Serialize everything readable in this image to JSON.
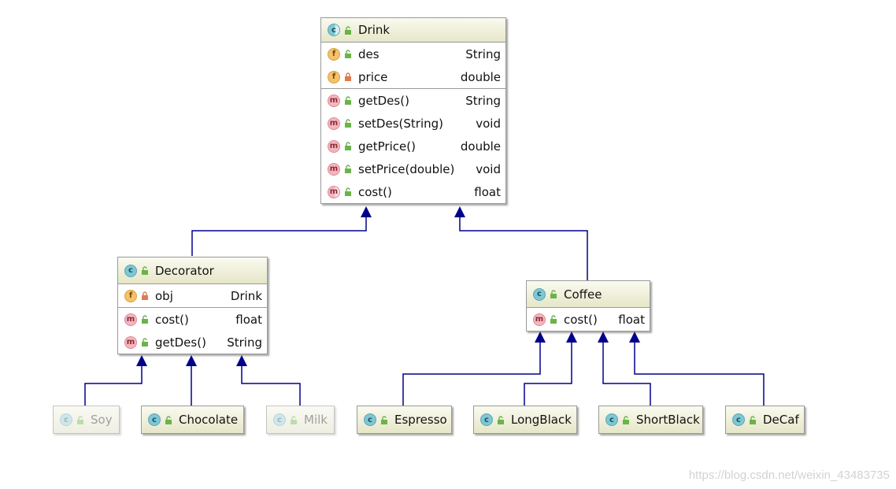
{
  "drink": {
    "name": "Drink",
    "fields": [
      {
        "name": "des",
        "type": "String",
        "visibility": "public"
      },
      {
        "name": "price",
        "type": "double",
        "visibility": "private"
      }
    ],
    "methods": [
      {
        "name": "getDes()",
        "type": "String"
      },
      {
        "name": "setDes(String)",
        "type": "void"
      },
      {
        "name": "getPrice()",
        "type": "double"
      },
      {
        "name": "setPrice(double)",
        "type": "void"
      },
      {
        "name": "cost()",
        "type": "float"
      }
    ]
  },
  "decorator": {
    "name": "Decorator",
    "fields": [
      {
        "name": "obj",
        "type": "Drink",
        "visibility": "private"
      }
    ],
    "methods": [
      {
        "name": "cost()",
        "type": "float"
      },
      {
        "name": "getDes()",
        "type": "String"
      }
    ]
  },
  "coffee": {
    "name": "Coffee",
    "methods": [
      {
        "name": "cost()",
        "type": "float"
      }
    ]
  },
  "leaves": {
    "soy": "Soy",
    "chocolate": "Chocolate",
    "milk": "Milk",
    "espresso": "Espresso",
    "longblack": "LongBlack",
    "shortblack": "ShortBlack",
    "decaf": "DeCaf"
  },
  "badges": {
    "class": "c",
    "field": "f",
    "method": "m"
  },
  "colors": {
    "edge": "#00008b",
    "header": "#e6e6c8"
  },
  "watermark": "https://blog.csdn.net/weixin_43483735"
}
